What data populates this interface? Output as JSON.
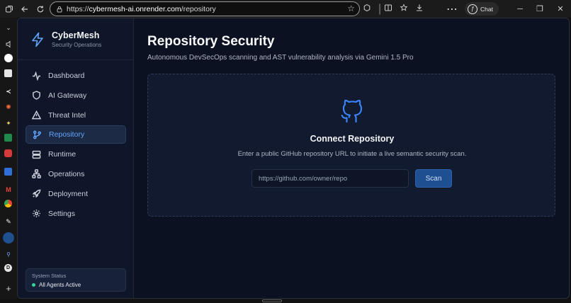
{
  "browser": {
    "url_scheme": "https://",
    "url_host": "cybermesh-ai.onrender.com",
    "url_path": "/repository",
    "chat_label": "Chat"
  },
  "app": {
    "brand_name": "CyberMesh",
    "brand_sub": "Security Operations",
    "accent": "#60a5fa",
    "nav": [
      {
        "label": "Dashboard",
        "icon": "activity-icon",
        "active": false
      },
      {
        "label": "AI Gateway",
        "icon": "shield-icon",
        "active": false
      },
      {
        "label": "Threat Intel",
        "icon": "warning-triangle-icon",
        "active": false
      },
      {
        "label": "Repository",
        "icon": "git-branch-icon",
        "active": true
      },
      {
        "label": "Runtime",
        "icon": "server-icon",
        "active": false
      },
      {
        "label": "Operations",
        "icon": "network-icon",
        "active": false
      },
      {
        "label": "Deployment",
        "icon": "rocket-icon",
        "active": false
      },
      {
        "label": "Settings",
        "icon": "gear-icon",
        "active": false
      }
    ],
    "status": {
      "title": "System Status",
      "value": "All Agents Active",
      "color": "#34d399"
    }
  },
  "main": {
    "title": "Repository Security",
    "subtitle": "Autonomous DevSecOps scanning and AST vulnerability analysis via Gemini 1.5 Pro",
    "card": {
      "icon": "github-icon",
      "title": "Connect Repository",
      "description": "Enter a public GitHub repository URL to initiate a live semantic security scan.",
      "input_placeholder": "https://github.com/owner/repo",
      "input_value": "",
      "scan_label": "Scan"
    }
  }
}
